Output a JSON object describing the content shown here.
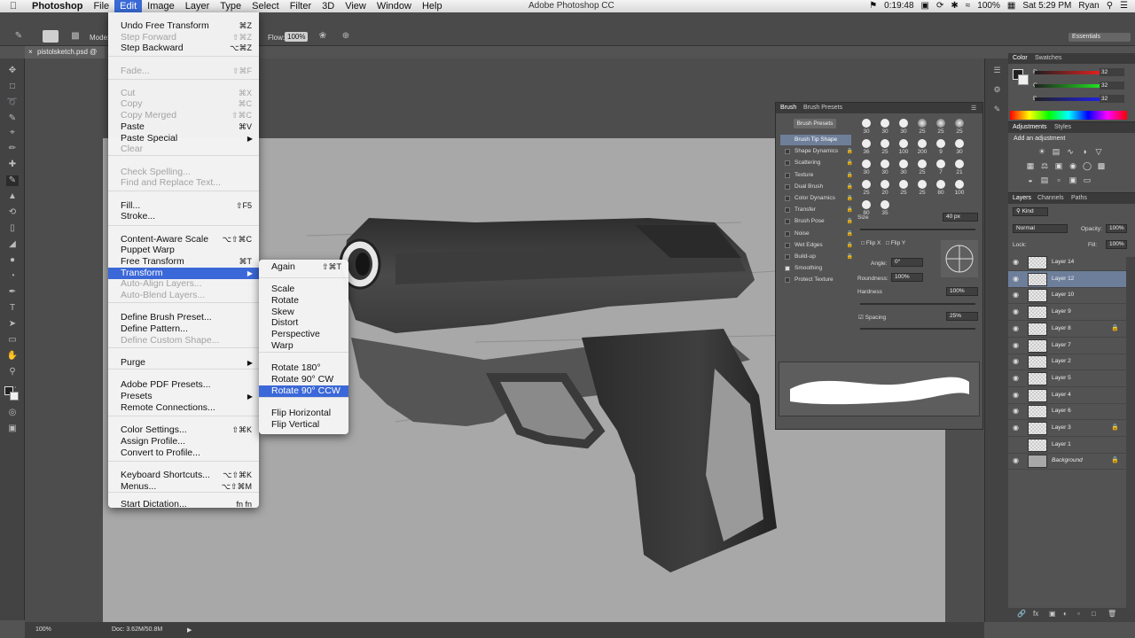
{
  "menubar": {
    "app": "Photoshop",
    "items": [
      "File",
      "Edit",
      "Image",
      "Layer",
      "Type",
      "Select",
      "Filter",
      "3D",
      "View",
      "Window",
      "Help"
    ],
    "active": "Edit",
    "window_title": "Adobe Photoshop CC",
    "timer": "0:19:48",
    "battery": "100%",
    "clock": "Sat 5:29 PM",
    "user": "Ryan"
  },
  "options": {
    "mode_label": "Mode:",
    "flow_label": "Flow:",
    "flow_value": "100%",
    "workspace": "Essentials"
  },
  "document": {
    "tab_title": "pistolsketch.psd @ 100"
  },
  "status": {
    "zoom": "100%",
    "doc": "Doc: 3.62M/50.8M"
  },
  "edit_menu": [
    {
      "label": "Undo Free Transform",
      "shortcut": "⌘Z"
    },
    {
      "label": "Step Forward",
      "shortcut": "⇧⌘Z",
      "disabled": true
    },
    {
      "label": "Step Backward",
      "shortcut": "⌥⌘Z"
    },
    {
      "label": "Fade...",
      "shortcut": "⇧⌘F",
      "disabled": true
    },
    {
      "label": "Cut",
      "shortcut": "⌘X",
      "disabled": true
    },
    {
      "label": "Copy",
      "shortcut": "⌘C",
      "disabled": true
    },
    {
      "label": "Copy Merged",
      "shortcut": "⇧⌘C",
      "disabled": true
    },
    {
      "label": "Paste",
      "shortcut": "⌘V"
    },
    {
      "label": "Paste Special",
      "shortcut": ""
    },
    {
      "label": "Clear",
      "shortcut": "",
      "disabled": true
    },
    {
      "label": "Check Spelling...",
      "shortcut": "",
      "disabled": true
    },
    {
      "label": "Find and Replace Text...",
      "shortcut": "",
      "disabled": true
    },
    {
      "label": "Fill...",
      "shortcut": "⇧F5"
    },
    {
      "label": "Stroke...",
      "shortcut": ""
    },
    {
      "label": "Content-Aware Scale",
      "shortcut": "⌥⇧⌘C"
    },
    {
      "label": "Puppet Warp",
      "shortcut": ""
    },
    {
      "label": "Free Transform",
      "shortcut": "⌘T"
    },
    {
      "label": "Transform",
      "shortcut": ""
    },
    {
      "label": "Auto-Align Layers...",
      "shortcut": "",
      "disabled": true
    },
    {
      "label": "Auto-Blend Layers...",
      "shortcut": "",
      "disabled": true
    },
    {
      "label": "Define Brush Preset...",
      "shortcut": ""
    },
    {
      "label": "Define Pattern...",
      "shortcut": ""
    },
    {
      "label": "Define Custom Shape...",
      "shortcut": "",
      "disabled": true
    },
    {
      "label": "Purge",
      "shortcut": ""
    },
    {
      "label": "Adobe PDF Presets...",
      "shortcut": ""
    },
    {
      "label": "Presets",
      "shortcut": ""
    },
    {
      "label": "Remote Connections...",
      "shortcut": ""
    },
    {
      "label": "Color Settings...",
      "shortcut": "⇧⌘K"
    },
    {
      "label": "Assign Profile...",
      "shortcut": ""
    },
    {
      "label": "Convert to Profile...",
      "shortcut": ""
    },
    {
      "label": "Keyboard Shortcuts...",
      "shortcut": "⌥⇧⌘K"
    },
    {
      "label": "Menus...",
      "shortcut": "⌥⇧⌘M"
    },
    {
      "label": "Start Dictation...",
      "shortcut": "fn fn"
    }
  ],
  "transform_menu": [
    {
      "label": "Again",
      "shortcut": "⇧⌘T"
    },
    {
      "label": "Scale"
    },
    {
      "label": "Rotate"
    },
    {
      "label": "Skew"
    },
    {
      "label": "Distort"
    },
    {
      "label": "Perspective"
    },
    {
      "label": "Warp"
    },
    {
      "label": "Rotate 180°"
    },
    {
      "label": "Rotate 90° CW"
    },
    {
      "label": "Rotate 90° CCW"
    },
    {
      "label": "Flip Horizontal"
    },
    {
      "label": "Flip Vertical"
    }
  ],
  "brush_panel": {
    "tabs": [
      "Brush",
      "Brush Presets"
    ],
    "presets_button": "Brush Presets",
    "options": [
      "Brush Tip Shape",
      "Shape Dynamics",
      "Scattering",
      "Texture",
      "Dual Brush",
      "Color Dynamics",
      "Transfer",
      "Brush Pose",
      "Noise",
      "Wet Edges",
      "Build-up",
      "Smoothing",
      "Protect Texture"
    ],
    "tip_sizes": [
      "30",
      "30",
      "30",
      "25",
      "25",
      "25",
      "36",
      "25",
      "100",
      "200",
      "9",
      "30",
      "30",
      "30",
      "30",
      "25",
      "7",
      "21",
      "25",
      "20",
      "25",
      "25",
      "80",
      "100",
      "80",
      "35"
    ],
    "size_label": "Size",
    "size_value": "40 px",
    "flipx": "Flip X",
    "flipy": "Flip Y",
    "angle_label": "Angle:",
    "angle_value": "0°",
    "roundness_label": "Roundness:",
    "roundness_value": "100%",
    "hardness_label": "Hardness",
    "hardness_value": "100%",
    "spacing_label": "Spacing",
    "spacing_value": "25%"
  },
  "color_panel": {
    "tabs": [
      "Color",
      "Swatches"
    ],
    "r": "32",
    "g": "32",
    "b": "32"
  },
  "adjustments": {
    "tabs": [
      "Adjustments",
      "Styles"
    ],
    "add_label": "Add an adjustment"
  },
  "layers": {
    "tabs": [
      "Layers",
      "Channels",
      "Paths"
    ],
    "kind": "Kind",
    "blend": "Normal",
    "opacity_label": "Opacity:",
    "opacity": "100%",
    "lock_label": "Lock:",
    "fill_label": "Fill:",
    "fill": "100%",
    "items": [
      {
        "name": "Layer 14"
      },
      {
        "name": "Layer 12",
        "selected": true
      },
      {
        "name": "Layer 10"
      },
      {
        "name": "Layer 9"
      },
      {
        "name": "Layer 8",
        "locked": true
      },
      {
        "name": "Layer 7"
      },
      {
        "name": "Layer 2"
      },
      {
        "name": "Layer 5"
      },
      {
        "name": "Layer 4"
      },
      {
        "name": "Layer 6"
      },
      {
        "name": "Layer 3",
        "locked": true
      },
      {
        "name": "Layer 1"
      },
      {
        "name": "Background",
        "locked": true
      }
    ]
  }
}
